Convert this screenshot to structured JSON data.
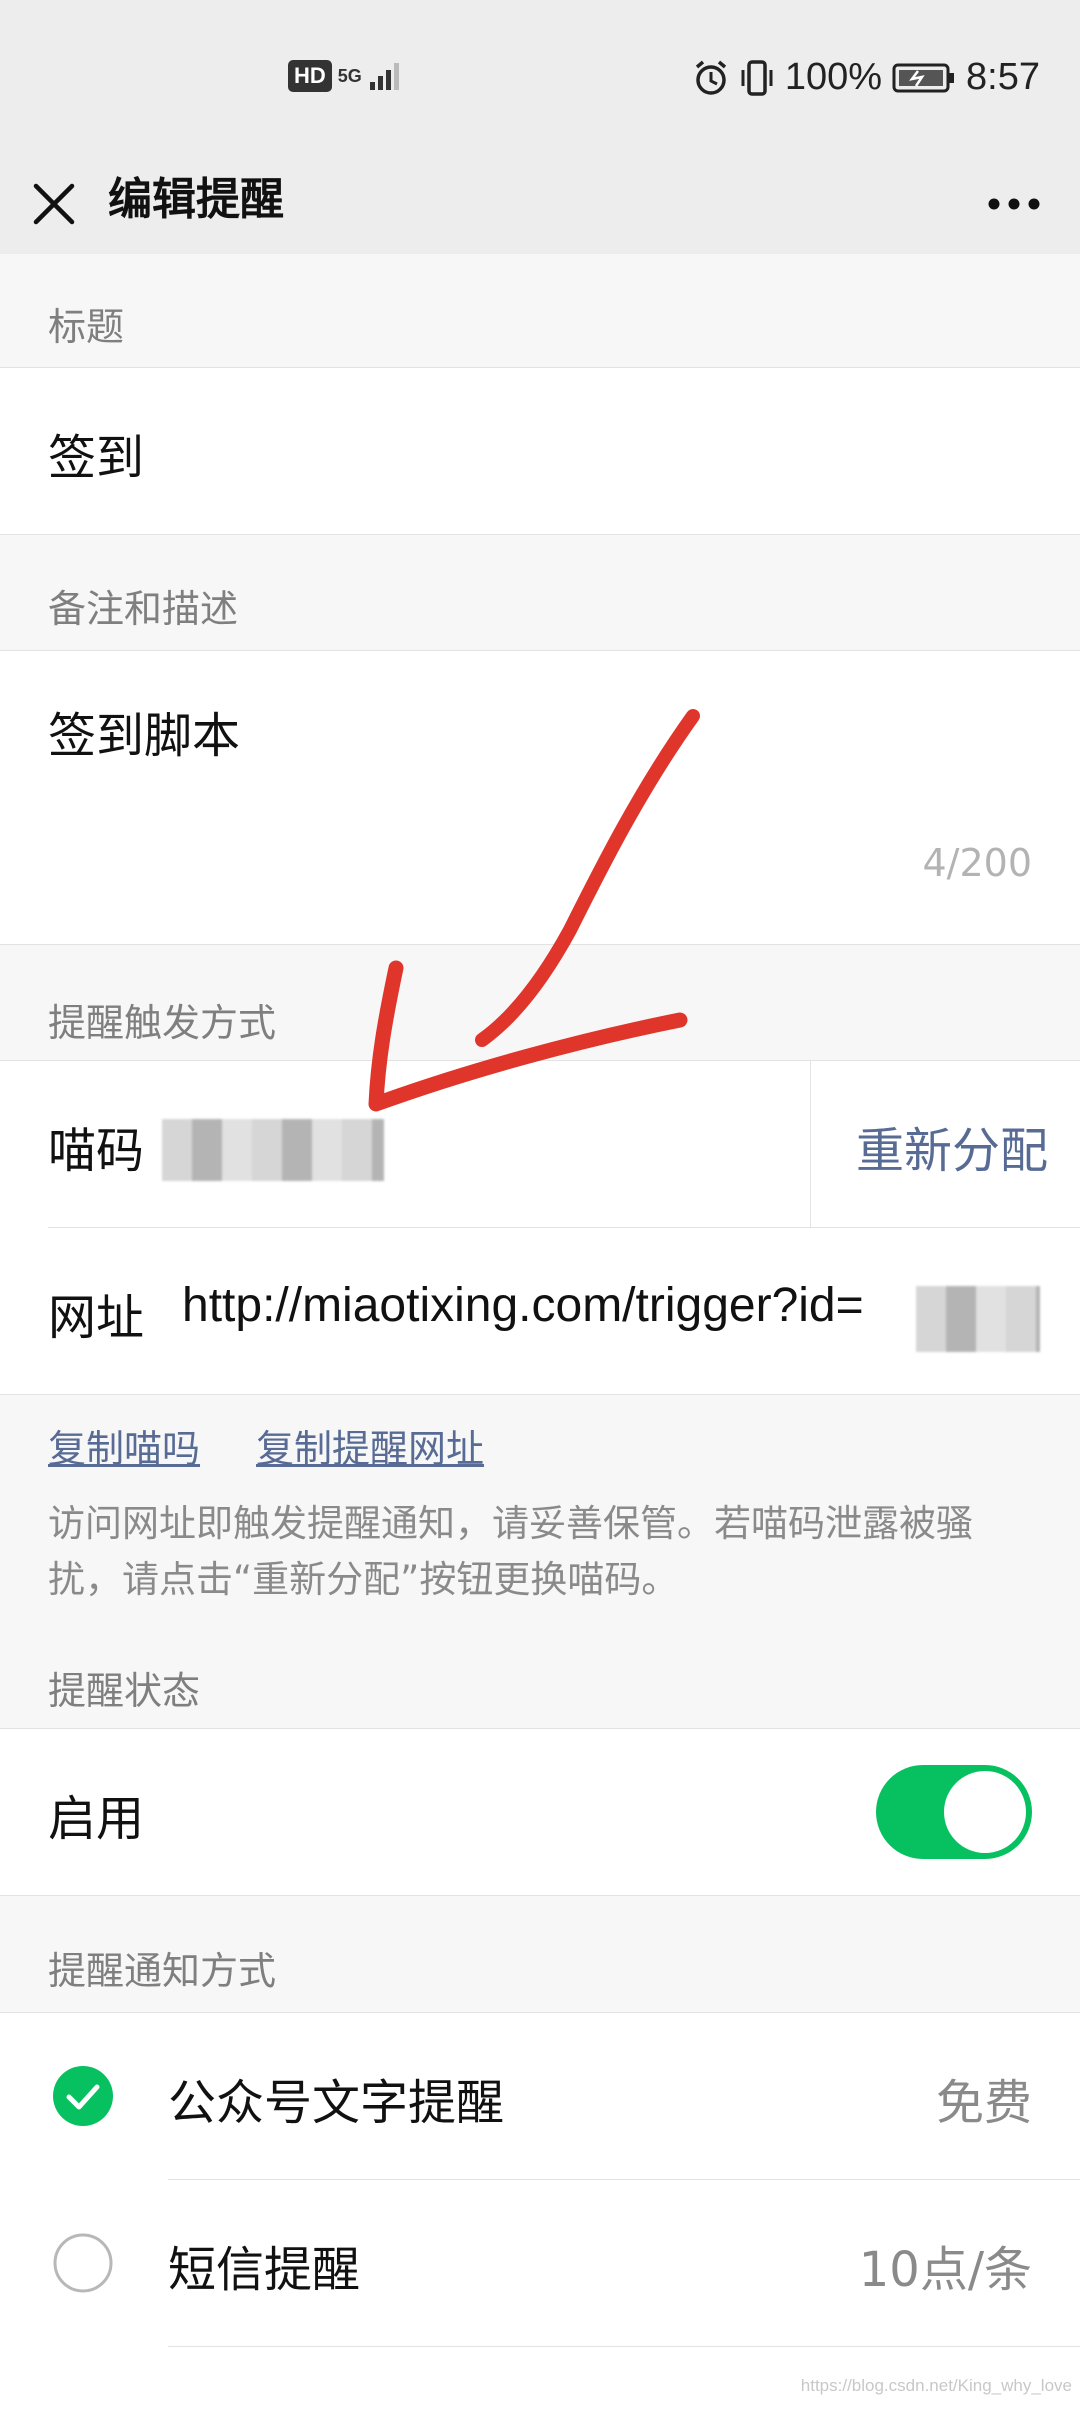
{
  "status_bar": {
    "hd": "HD",
    "network": "5G",
    "battery": "100%",
    "time": "8:57"
  },
  "nav": {
    "title": "编辑提醒"
  },
  "title_section": {
    "label": "标题",
    "value": "签到"
  },
  "desc_section": {
    "label": "备注和描述",
    "value": "签到脚本",
    "counter": "4/200"
  },
  "trigger_section": {
    "label": "提醒触发方式",
    "code_label": "喵码",
    "reassign": "重新分配",
    "url_label": "网址",
    "url_value": "http://miaotixing.com/trigger?id=",
    "copy_code": "复制喵吗",
    "copy_url": "复制提醒网址",
    "note": "访问网址即触发提醒通知，请妥善保管。若喵码泄露被骚扰，请点击“重新分配”按钮更换喵码。"
  },
  "status_section": {
    "label": "提醒状态",
    "enable_label": "启用",
    "enabled": true
  },
  "notify_section": {
    "label": "提醒通知方式",
    "options": [
      {
        "label": "公众号文字提醒",
        "price": "免费",
        "selected": true
      },
      {
        "label": "短信提醒",
        "price": "10点/条",
        "selected": false
      }
    ]
  },
  "watermark": "https://blog.csdn.net/King_why_love",
  "colors": {
    "accent_green": "#07c160",
    "link_blue": "#576b95",
    "annotation_red": "#e0352b"
  }
}
